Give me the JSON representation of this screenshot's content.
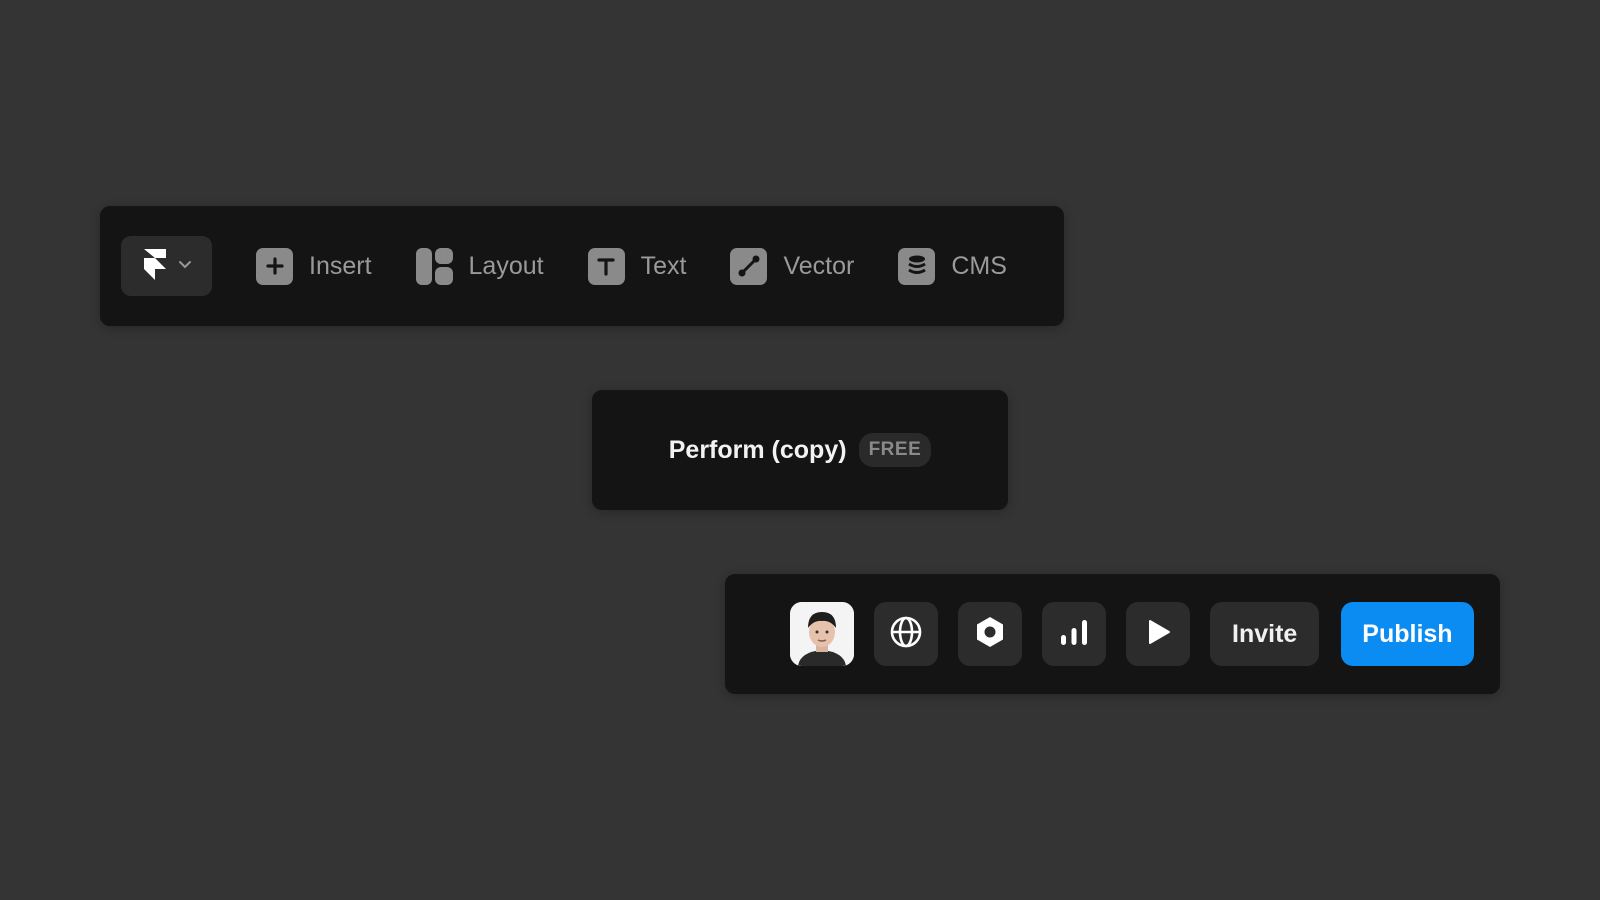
{
  "toolbar": {
    "logo_icon": "framer-logo-icon",
    "menu_icon": "chevron-down-icon",
    "items": [
      {
        "label": "Insert",
        "icon": "plus-icon"
      },
      {
        "label": "Layout",
        "icon": "layout-icon"
      },
      {
        "label": "Text",
        "icon": "text-icon"
      },
      {
        "label": "Vector",
        "icon": "vector-pen-icon"
      },
      {
        "label": "CMS",
        "icon": "database-icon"
      }
    ]
  },
  "project": {
    "title": "Perform (copy)",
    "plan": "FREE"
  },
  "actions": {
    "avatar_icon": "user-avatar",
    "buttons": [
      {
        "name": "globe-icon"
      },
      {
        "name": "settings-hexagon-icon"
      },
      {
        "name": "analytics-bars-icon"
      },
      {
        "name": "play-icon"
      }
    ],
    "invite_label": "Invite",
    "publish_label": "Publish"
  },
  "colors": {
    "background": "#343434",
    "panel": "#141414",
    "button": "#2c2c2c",
    "accent": "#0b8cf3",
    "muted_text": "#9a9a9a"
  }
}
